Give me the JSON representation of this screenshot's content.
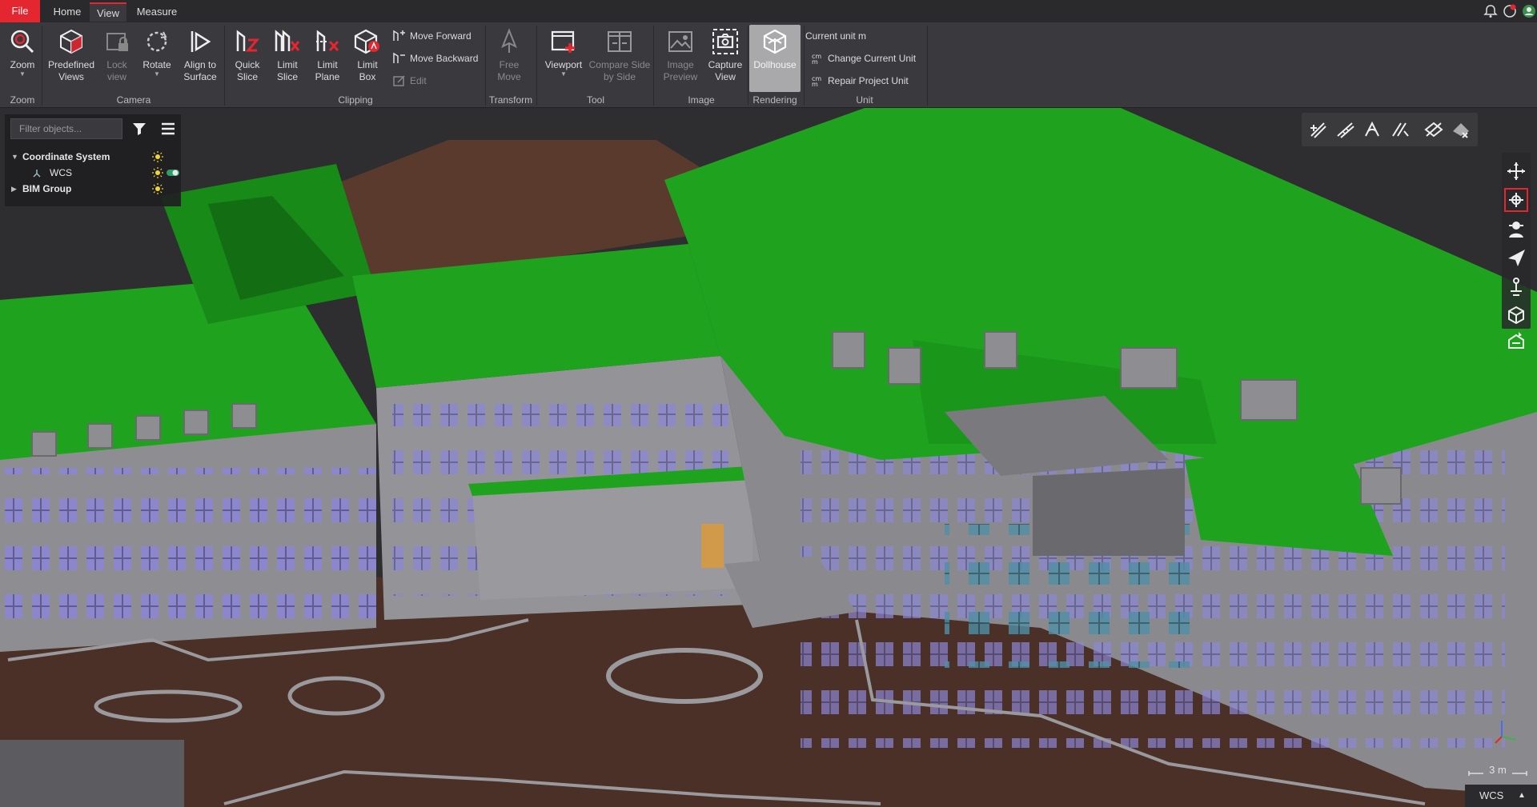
{
  "menu": {
    "file": "File",
    "home": "Home",
    "view": "View",
    "measure": "Measure"
  },
  "ribbon": {
    "zoom": "Zoom",
    "predefined_views": "Predefined\nViews",
    "lock_view": "Lock\nview",
    "rotate": "Rotate",
    "align_to_surface": "Align to\nSurface",
    "quick_slice": "Quick\nSlice",
    "limit_slice": "Limit\nSlice",
    "limit_plane": "Limit\nPlane",
    "limit_box": "Limit\nBox",
    "move_forward": "Move Forward",
    "move_backward": "Move Backward",
    "edit": "Edit",
    "free_move": "Free\nMove",
    "viewport": "Viewport",
    "compare_side_by_side": "Compare Side\nby Side",
    "image_preview": "Image\nPreview",
    "capture_view": "Capture\nView",
    "dollhouse": "Dollhouse",
    "current_unit": "Current unit  m",
    "change_current_unit": "Change Current Unit",
    "repair_project_unit": "Repair Project Unit",
    "groups": {
      "zoom": "Zoom",
      "camera": "Camera",
      "clipping": "Clipping",
      "transform": "Transform",
      "tool": "Tool",
      "image": "Image",
      "rendering": "Rendering",
      "unit": "Unit"
    }
  },
  "tree": {
    "filter_placeholder": "Filter objects...",
    "items": [
      {
        "label": "Coordinate System"
      },
      {
        "label": "WCS"
      },
      {
        "label": "BIM Group"
      }
    ]
  },
  "viewport": {
    "scale": "3 m",
    "coordinate_system": "WCS"
  },
  "colors": {
    "accent": "#e3262f",
    "roof": "#1fa31f",
    "wall": "#8e8e92",
    "ground": "#4a3026",
    "window": "#8c86d4"
  },
  "icons": {
    "view_toolbar": [
      "measure-area-icon",
      "measure-distance-icon",
      "measure-angle-icon",
      "measure-height-icon",
      "hide-annotations-icon",
      "clear-measure-icon"
    ],
    "nav_bar": [
      "orbit-icon",
      "pan-icon",
      "walk-icon",
      "fly-icon",
      "person-icon",
      "box-view-icon",
      "dollhouse-view-icon"
    ]
  }
}
